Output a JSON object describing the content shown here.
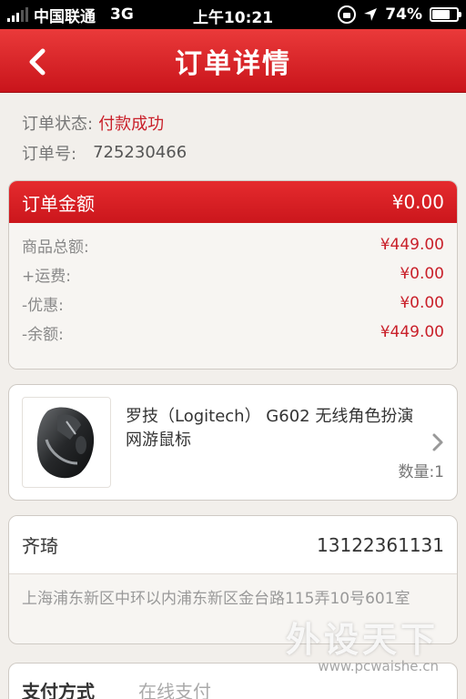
{
  "status_bar": {
    "carrier": "中国联通",
    "network": "3G",
    "time": "上午10:21",
    "battery": "74%",
    "battery_level": 0.74
  },
  "nav": {
    "title": "订单详情",
    "back_icon": "chevron-left-icon"
  },
  "order": {
    "status_label": "订单状态:",
    "status_value": "付款成功",
    "number_label": "订单号:",
    "number_value": "725230466"
  },
  "amount": {
    "header_label": "订单金额",
    "header_value": "¥0.00",
    "rows": [
      {
        "label": "商品总额:",
        "value": "¥449.00"
      },
      {
        "label": "+运费:",
        "value": "¥0.00"
      },
      {
        "label": "-优惠:",
        "value": "¥0.00"
      },
      {
        "label": "-余额:",
        "value": "¥449.00"
      }
    ]
  },
  "product": {
    "name": "罗技（Logitech） G602 无线角色扮演网游鼠标",
    "quantity": "数量:1",
    "image_icon": "mouse-product-image"
  },
  "address": {
    "name": "齐琦",
    "phone": "13122361131",
    "detail": "上海浦东新区中环以内浦东新区金台路115弄10号601室"
  },
  "payment": {
    "label": "支付方式",
    "value": "在线支付"
  },
  "watermark": {
    "title": "外设天下",
    "url": "www.pcwaishe.cn"
  },
  "colors": {
    "accent": "#d3191f",
    "price": "#c9202a",
    "background": "#f2efeb"
  }
}
